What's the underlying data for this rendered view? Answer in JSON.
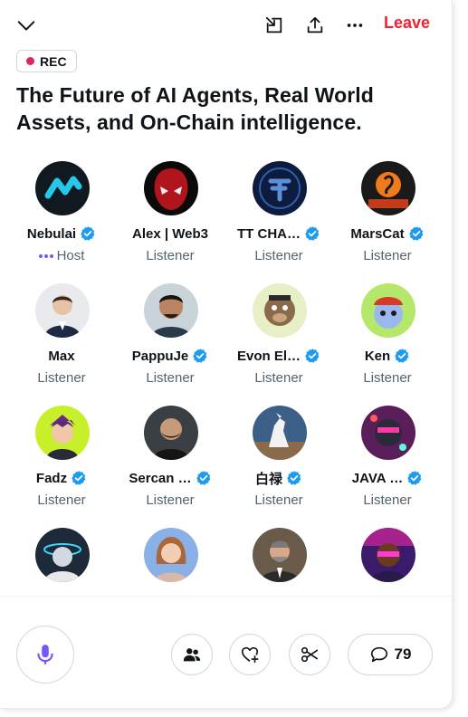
{
  "topbar": {
    "leave_label": "Leave",
    "icons": [
      "chevron-down-icon",
      "dock-window-icon",
      "share-icon",
      "more-icon"
    ]
  },
  "rec_badge": "REC",
  "title": "The Future of AI Agents, Real World Assets, and On-Chain intelligence.",
  "participants": [
    {
      "name": "Nebulai",
      "role": "Host",
      "verified": true
    },
    {
      "name": "Alex | Web3",
      "role": "Listener",
      "verified": false
    },
    {
      "name": "TT CHA…",
      "role": "Listener",
      "verified": true
    },
    {
      "name": "MarsCat",
      "role": "Listener",
      "verified": true
    },
    {
      "name": "Max",
      "role": "Listener",
      "verified": false
    },
    {
      "name": "PappuJe",
      "role": "Listener",
      "verified": true
    },
    {
      "name": "Evon El…",
      "role": "Listener",
      "verified": true
    },
    {
      "name": "Ken",
      "role": "Listener",
      "verified": true
    },
    {
      "name": "Fadz",
      "role": "Listener",
      "verified": true
    },
    {
      "name": "Sercan …",
      "role": "Listener",
      "verified": true
    },
    {
      "name": "白禄",
      "role": "Listener",
      "verified": true
    },
    {
      "name": "JAVA …",
      "role": "Listener",
      "verified": true
    },
    {
      "name": "",
      "role": "",
      "verified": false
    },
    {
      "name": "",
      "role": "",
      "verified": false
    },
    {
      "name": "",
      "role": "",
      "verified": false
    },
    {
      "name": "",
      "role": "",
      "verified": false
    }
  ],
  "footer": {
    "comment_count": "79"
  },
  "colors": {
    "accent": "#1d9bf0",
    "leave": "#f4212e",
    "rec_dot": "#e0245e",
    "mic": "#7856ff"
  }
}
